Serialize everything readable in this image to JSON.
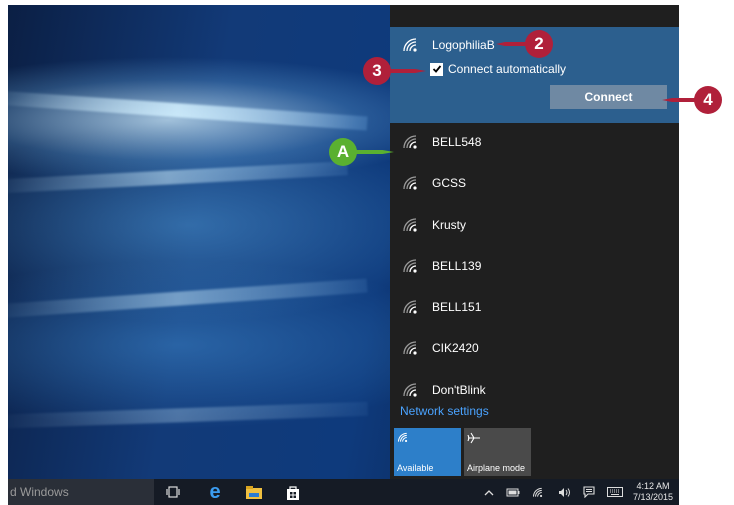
{
  "taskbar": {
    "search_text": "d Windows",
    "clock_time": "4:12 AM",
    "clock_date": "7/13/2015",
    "app_icons": [
      "task-view-icon",
      "edge-icon",
      "file-explorer-icon",
      "store-icon"
    ],
    "tray_icons": [
      "chevron-up-icon",
      "battery-icon",
      "wifi-icon",
      "volume-icon",
      "action-center-icon",
      "keyboard-icon"
    ]
  },
  "network_flyout": {
    "selected_network": {
      "name": "LogophiliaB",
      "connect_auto_label": "Connect automatically",
      "connect_auto_checked": true,
      "connect_button": "Connect"
    },
    "networks": [
      "BELL548",
      "GCSS",
      "Krusty",
      "BELL139",
      "BELL151",
      "CIK2420",
      "Don'tBlink"
    ],
    "network_settings_link": "Network settings",
    "quick_actions": [
      {
        "label": "Available",
        "icon": "wifi-icon",
        "active": true
      },
      {
        "label": "Airplane mode",
        "icon": "airplane-icon",
        "active": false
      }
    ]
  },
  "callouts": {
    "c2": "2",
    "c3": "3",
    "c4": "4",
    "cA": "A"
  },
  "colors": {
    "callout_red": "#b0203a",
    "callout_green": "#5ab030",
    "selected_bg": "#2c5f8e",
    "flyout_bg": "#1f1f1f",
    "link_blue": "#4aa3ff",
    "tile_active": "#2d7fc9",
    "tile_inactive": "#4a4a4a"
  }
}
